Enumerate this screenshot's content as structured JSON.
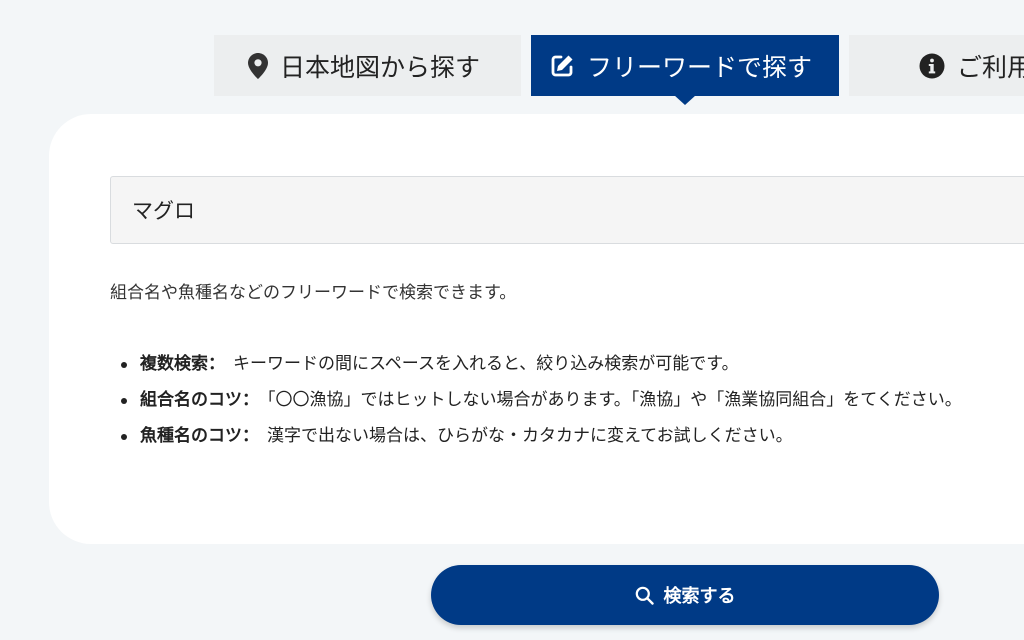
{
  "tabs": [
    {
      "label": "日本地図から探す",
      "icon": "map-pin-icon"
    },
    {
      "label": "フリーワードで探す",
      "icon": "edit-icon"
    },
    {
      "label": "ご利用",
      "icon": "info-icon"
    }
  ],
  "search": {
    "value": "マグロ",
    "description": "組合名や魚種名などのフリーワードで検索できます。"
  },
  "tips": [
    {
      "label": "複数検索：",
      "text": "キーワードの間にスペースを入れると、絞り込み検索が可能です。"
    },
    {
      "label": "組合名のコツ：",
      "text": "「〇〇漁協」ではヒットしない場合があります。「漁協」や「漁業協同組合」をてください。"
    },
    {
      "label": "魚種名のコツ：",
      "text": "漢字で出ない場合は、ひらがな・カタカナに変えてお試しください。"
    }
  ],
  "search_button": {
    "label": "検索する",
    "icon": "search-icon"
  },
  "colors": {
    "accent": "#003a86",
    "background": "#f3f6f8",
    "tab_inactive": "#eceeef"
  }
}
